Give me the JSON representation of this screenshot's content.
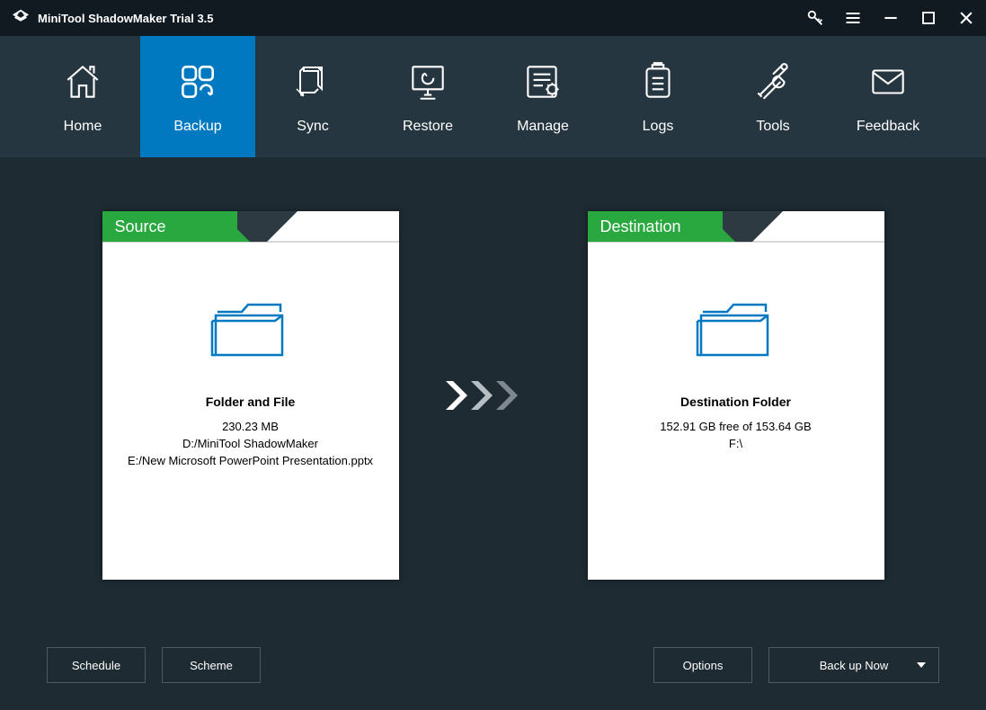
{
  "app": {
    "title": "MiniTool ShadowMaker Trial 3.5"
  },
  "nav": {
    "home": "Home",
    "backup": "Backup",
    "sync": "Sync",
    "restore": "Restore",
    "manage": "Manage",
    "logs": "Logs",
    "tools": "Tools",
    "feedback": "Feedback"
  },
  "source": {
    "title": "Source",
    "heading": "Folder and File",
    "size": "230.23 MB",
    "path1": "D:/MiniTool ShadowMaker",
    "path2": "E:/New Microsoft PowerPoint Presentation.pptx"
  },
  "destination": {
    "title": "Destination",
    "heading": "Destination Folder",
    "free": "152.91 GB free of 153.64 GB",
    "path": "F:\\"
  },
  "footer": {
    "schedule": "Schedule",
    "scheme": "Scheme",
    "options": "Options",
    "backup_now": "Back up Now"
  }
}
